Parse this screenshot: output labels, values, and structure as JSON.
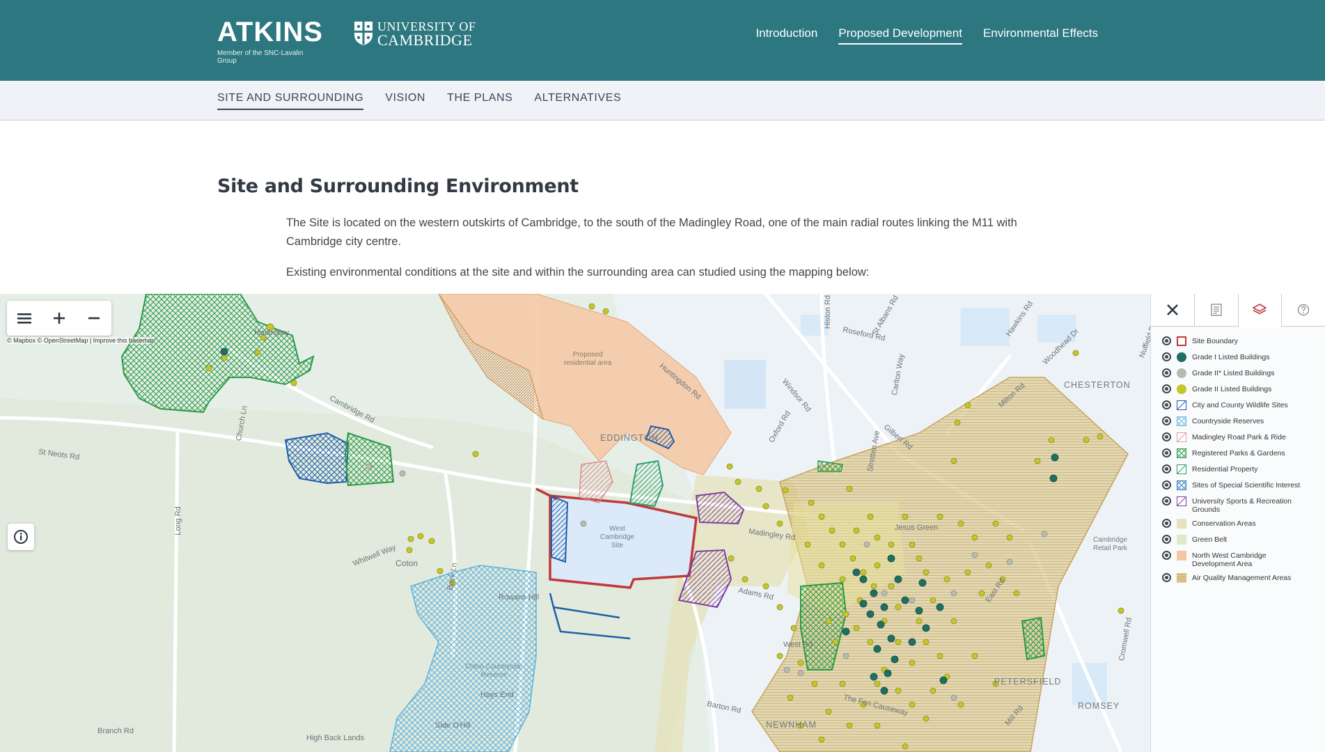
{
  "header": {
    "brand_name": "ATKINS",
    "brand_tagline": "Member of the SNC-Lavalin Group",
    "partner_line1": "UNIVERSITY OF",
    "partner_line2": "CAMBRIDGE",
    "nav": [
      {
        "label": "Introduction",
        "active": false
      },
      {
        "label": "Proposed Development",
        "active": true
      },
      {
        "label": "Environmental Effects",
        "active": false
      }
    ]
  },
  "subnav": {
    "items": [
      {
        "label": "SITE AND SURROUNDING",
        "active": true
      },
      {
        "label": "VISION",
        "active": false
      },
      {
        "label": "THE PLANS",
        "active": false
      },
      {
        "label": "ALTERNATIVES",
        "active": false
      }
    ]
  },
  "content": {
    "title": "Site and Surrounding Environment",
    "paragraph1": "The Site is located on the western outskirts of Cambridge, to the south of the Madingley Road, one of the main radial routes linking the M11 with Cambridge city centre.",
    "paragraph2": "Existing environmental conditions at the site and within the surrounding area can studied using the mapping below:"
  },
  "map": {
    "attribution": "© Mapbox © OpenStreetMap | Improve this basemap",
    "controls": {
      "menu_icon": "hamburger-icon",
      "zoom_in_icon": "plus-icon",
      "zoom_out_icon": "minus-icon",
      "info_icon": "info-icon"
    },
    "labels": {
      "madingley": "Madingley",
      "chesterton": "CHESTERTON",
      "eddington": "EDDINGTON",
      "coton": "Coton",
      "west_cambridge": "West\nCambridge\nSite",
      "proposed_residential": "Proposed\nresidential area",
      "petersfield": "PETERSFIELD",
      "romsey": "ROMSEY",
      "newnham": "NEWNHAM",
      "st_neots_rd": "St Neots Rd",
      "long_rd": "Long Rd",
      "branch_rd": "Branch Rd",
      "high_back_lands": "High Back Lands",
      "side_ohill": "Side O'Hill",
      "hays_end": "Hays End",
      "rowans_hill": "Rowans Hill",
      "coton_countryside_reserve": "Coton Countryside\nReserve",
      "cambridge_rd": "Cambridge Rd",
      "huntingdon_rd": "Huntingdon Rd",
      "histon_rd": "Histon Rd",
      "milton_rd": "Milton Rd",
      "gilbert_rd": "Gilbert Rd",
      "madingley_rd": "Madingley Rd",
      "whitwell_way": "Whitwell Way",
      "adams_rd": "Adams Rd",
      "west_rd": "West Rd",
      "cambridge_retail_park": "Cambridge\nRetail Park",
      "jesus_green": "Jesus Green",
      "the_fen_causeway": "The Fen Causeway",
      "east_rd": "East Rd",
      "mill_rd": "Mill Rd",
      "cromwell_rd": "Cromwell Rd",
      "roseford_rd": "Roseford Rd",
      "woodhead_dr": "Woodhead Dr",
      "carlton_way": "Carlton Way",
      "windsor_rd": "Windsor Rd",
      "oxford_rd": "Oxford Rd",
      "church_ln": "Church Ln",
      "back_ln": "Back Ln",
      "stretten_ave": "Stretten Ave",
      "st_albans_rd": "St Albans Rd",
      "barton_rd": "Barton Rd",
      "nuffield_rd": "Nuffield Rd",
      "hawkins_rd": "Hawkins Rd"
    }
  },
  "panel": {
    "tabs": [
      {
        "icon": "close-icon"
      },
      {
        "icon": "document-icon"
      },
      {
        "icon": "layers-icon",
        "active": true
      },
      {
        "icon": "help-icon"
      }
    ],
    "legend": [
      {
        "label": "Site Boundary",
        "swatch": "outline",
        "color": "#c0393b"
      },
      {
        "label": "Grade I Listed Buildings",
        "swatch": "dot",
        "color": "#1f6f63"
      },
      {
        "label": "Grade II* Listed Buildings",
        "swatch": "dot",
        "color": "#b8bcaf"
      },
      {
        "label": "Grade II Listed Buildings",
        "swatch": "dot",
        "color": "#c4c62c"
      },
      {
        "label": "City and County Wildlife Sites",
        "swatch": "diag",
        "color": "#1e5ea8"
      },
      {
        "label": "Countryside Reserves",
        "swatch": "cross",
        "color": "#6fb7e0"
      },
      {
        "label": "Madingley Road Park & Ride",
        "swatch": "diag",
        "color": "#e89aa0"
      },
      {
        "label": "Registered Parks & Gardens",
        "swatch": "cross",
        "color": "#2a9a46"
      },
      {
        "label": "Residential Property",
        "swatch": "diag",
        "color": "#2aa06a"
      },
      {
        "label": "Sites of Special Scientific Interest",
        "swatch": "cross",
        "color": "#3a7cc2"
      },
      {
        "label": "University Sports & Recreation Grounds",
        "swatch": "diag",
        "color": "#7b3fa0"
      },
      {
        "label": "Conservation Areas",
        "swatch": "fill",
        "color": "#e6e2bb"
      },
      {
        "label": "Green Belt",
        "swatch": "fill",
        "color": "#dfe9c9"
      },
      {
        "label": "North West Cambridge Development Area",
        "swatch": "fill",
        "color": "#f4c7a2"
      },
      {
        "label": "Air Quality Management Areas",
        "swatch": "stripes",
        "color": "#c7a25c"
      }
    ]
  }
}
